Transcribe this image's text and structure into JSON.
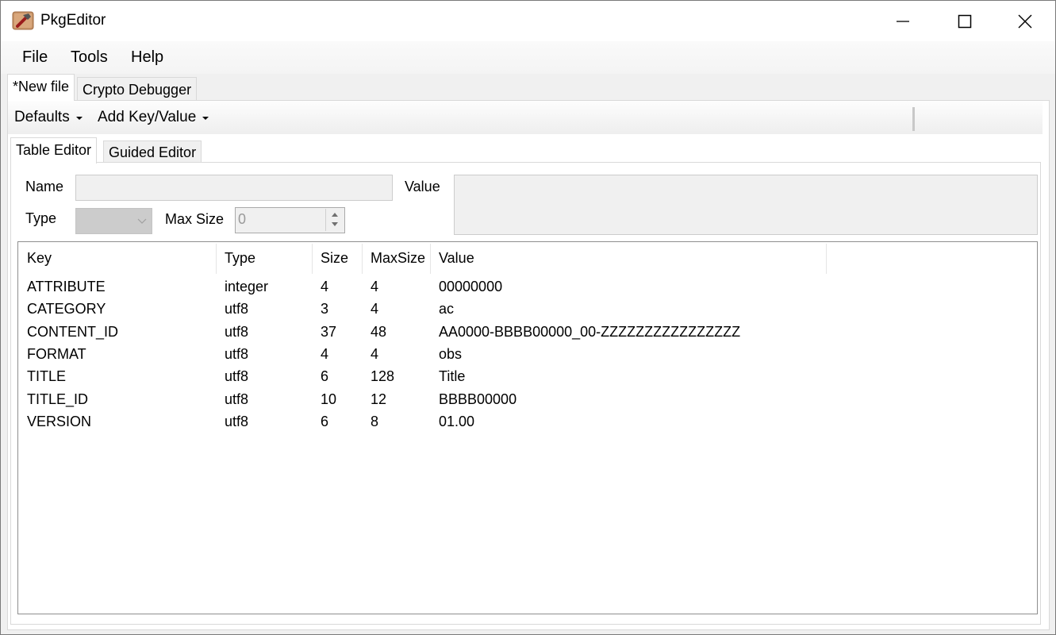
{
  "window": {
    "title": "PkgEditor",
    "icon": "hammer-package-icon",
    "controls": {
      "minimize": "minimize-icon",
      "maximize": "maximize-icon",
      "close": "close-icon"
    }
  },
  "menu": {
    "items": [
      {
        "label": "File"
      },
      {
        "label": "Tools"
      },
      {
        "label": "Help"
      }
    ]
  },
  "doc_tabs": [
    {
      "label": "*New file",
      "active": true
    },
    {
      "label": "Crypto Debugger",
      "active": false
    }
  ],
  "toolbar": {
    "defaults_label": "Defaults",
    "add_kv_label": "Add Key/Value"
  },
  "editor_tabs": [
    {
      "label": "Table Editor",
      "active": true
    },
    {
      "label": "Guided Editor",
      "active": false
    }
  ],
  "form": {
    "name_label": "Name",
    "name_value": "",
    "value_label": "Value",
    "value_value": "",
    "type_label": "Type",
    "type_value": "",
    "max_size_label": "Max Size",
    "max_size_value": "0"
  },
  "table": {
    "columns": [
      "Key",
      "Type",
      "Size",
      "MaxSize",
      "Value"
    ],
    "rows": [
      {
        "key": "ATTRIBUTE",
        "type": "integer",
        "size": "4",
        "maxsize": "4",
        "value": "00000000"
      },
      {
        "key": "CATEGORY",
        "type": "utf8",
        "size": "3",
        "maxsize": "4",
        "value": "ac"
      },
      {
        "key": "CONTENT_ID",
        "type": "utf8",
        "size": "37",
        "maxsize": "48",
        "value": "AA0000-BBBB00000_00-ZZZZZZZZZZZZZZZZ"
      },
      {
        "key": "FORMAT",
        "type": "utf8",
        "size": "4",
        "maxsize": "4",
        "value": "obs"
      },
      {
        "key": "TITLE",
        "type": "utf8",
        "size": "6",
        "maxsize": "128",
        "value": "Title"
      },
      {
        "key": "TITLE_ID",
        "type": "utf8",
        "size": "10",
        "maxsize": "12",
        "value": "BBBB00000"
      },
      {
        "key": "VERSION",
        "type": "utf8",
        "size": "6",
        "maxsize": "8",
        "value": "01.00"
      }
    ]
  }
}
